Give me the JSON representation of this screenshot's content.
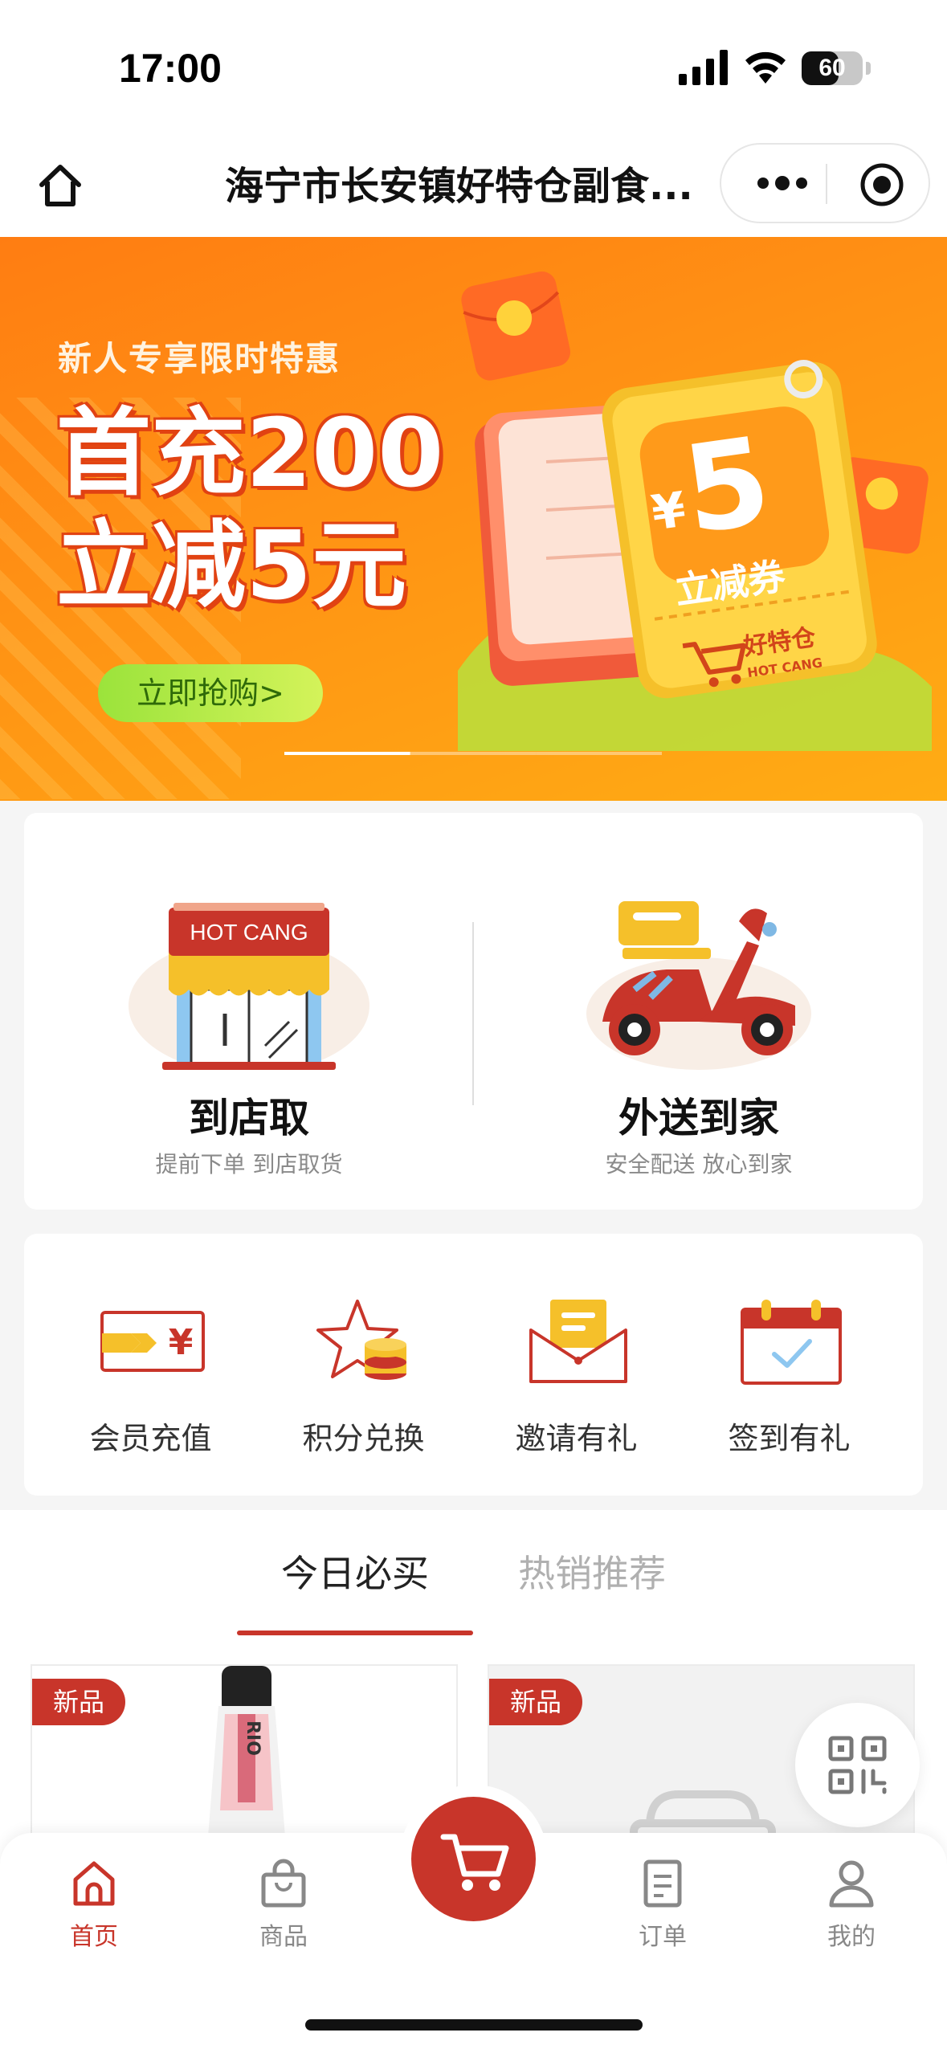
{
  "status_bar": {
    "time": "17:00",
    "battery": "60",
    "battery_level": 0.6
  },
  "nav": {
    "title": "海宁市长安镇好特仓副食..."
  },
  "banner": {
    "subtitle": "新人专享限时特惠",
    "headline_1": "首充200",
    "headline_2": "立减5元",
    "cta": "立即抢购>",
    "coupon_currency": "¥",
    "coupon_amount": "5",
    "coupon_label": "立减券",
    "coupon_brand": "好特仓",
    "coupon_brand_en": "HOT CANG",
    "slides": 3,
    "active_slide": 0
  },
  "services": [
    {
      "title": "到店取",
      "desc": "提前下单 到店取货",
      "sign": "HOT CANG",
      "icon": "store-icon"
    },
    {
      "title": "外送到家",
      "desc": "安全配送 放心到家",
      "icon": "scooter-icon"
    }
  ],
  "quick_actions": [
    {
      "label": "会员充值",
      "icon": "recharge-card-icon"
    },
    {
      "label": "积分兑换",
      "icon": "points-exchange-icon"
    },
    {
      "label": "邀请有礼",
      "icon": "invite-envelope-icon"
    },
    {
      "label": "签到有礼",
      "icon": "checkin-calendar-icon"
    }
  ],
  "tabs": {
    "active": "今日必买",
    "inactive": "热销推荐"
  },
  "products": [
    {
      "badge": "新品",
      "bottle_label": "RIO"
    },
    {
      "badge": "新品"
    }
  ],
  "tab_bar": {
    "items": [
      {
        "label": "首页",
        "icon": "home-icon",
        "active": true
      },
      {
        "label": "商品",
        "icon": "bag-icon",
        "active": false
      },
      {
        "label": "订单",
        "icon": "order-icon",
        "active": false
      },
      {
        "label": "我的",
        "icon": "user-icon",
        "active": false
      }
    ],
    "center_icon": "cart-icon"
  },
  "colors": {
    "brand_red": "#c8352a",
    "banner_orange": "#ff8a14",
    "cta_green": "#9be33b",
    "accent_yellow": "#f5c02a"
  }
}
